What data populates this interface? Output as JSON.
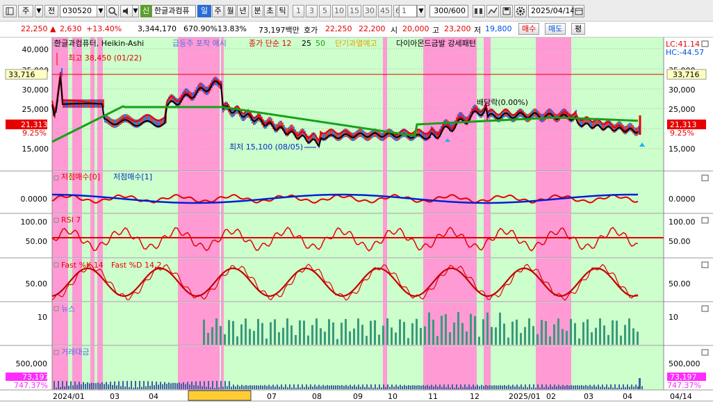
{
  "toolbar": {
    "stock_type": "주",
    "prev_label": "전",
    "code": "030520",
    "badge": "신",
    "stock_name": "한글과컴퓨",
    "period_buttons": [
      "일",
      "주",
      "월",
      "년",
      "분",
      "초",
      "틱"
    ],
    "active_period": "일",
    "minute_buttons": [
      "1",
      "3",
      "5",
      "10",
      "15",
      "30",
      "45",
      "60"
    ],
    "count_value": "1",
    "count_range": "300/600",
    "date": "2025/04/14"
  },
  "quote": {
    "price": "22,250",
    "change_arrow": "▲",
    "change": "2,630",
    "change_pct": "+13.40%",
    "volume": "3,344,170",
    "volume_ratio": "670.90%",
    "turnover": "13.83%",
    "amount": "73,197백만",
    "hoga_label": "호가",
    "ask": "22,250",
    "bid": "22,200",
    "open_label": "시",
    "open": "20,000",
    "high_label": "고",
    "high": "23,200",
    "low_label": "저",
    "low": "19,800",
    "buy_button": "매수",
    "sell_button": "매도",
    "eval_button": "평"
  },
  "legend": {
    "series1": "한글과컴퓨터, Heikin-Ashi",
    "series2": "급등주 포착 예시",
    "series3_prefix": "종가 단순 12",
    "ma25": "25",
    "ma50": "50",
    "series4": "단기과열예고",
    "series5": "다이아몬드금발 강세패턴"
  },
  "annotations": {
    "high_note": "최고 38,450 (01/22)",
    "low_note": "최저 15,100 (08/05)",
    "dividend": "배당락(0.00%)",
    "lc": "LC:41.14",
    "hc": "HC:-44.57"
  },
  "price_axis": [
    "40,000",
    "35,000",
    "30,000",
    "25,000",
    "20,000",
    "15,000"
  ],
  "current_marks": {
    "line_price": "33,716",
    "current": "21,313",
    "pct": "9.25%"
  },
  "panels": {
    "p2_title_a": "저점매수[0]",
    "p2_title_b": "저점매수[1]",
    "p2_axis": "0.0000",
    "p3_title": "RSI 7",
    "p3_axis": [
      "100.00",
      "50.00"
    ],
    "p4_title_a": "Fast %K 14",
    "p4_title_b": "Fast %D 14,2",
    "p4_axis": "50.00",
    "p5_title": "뉴스",
    "p5_axis": "10",
    "p6_title": "거래대금",
    "p6_axis": "500,000",
    "p6_current": "73,197",
    "p6_pct": "747.37%"
  },
  "x_axis": [
    "2024/01",
    "03",
    "04",
    "07",
    "08",
    "09",
    "10",
    "11",
    "12",
    "2025/01",
    "02",
    "03",
    "04",
    "04/14"
  ],
  "colors": {
    "up": "#e60000",
    "down": "#0050e6",
    "ma12": "#e60000",
    "ma25": "#000000",
    "ma50": "#18a018",
    "band_green": "#ccffcc",
    "band_pink": "#ff9ad5",
    "news": "#3a9a7a",
    "current": "#e60000"
  }
}
